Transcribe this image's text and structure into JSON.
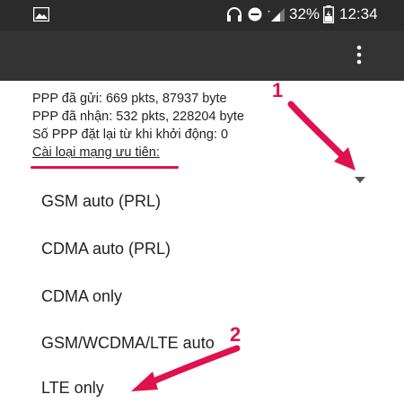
{
  "status_bar": {
    "battery_percent": "32%",
    "time": "12:34",
    "icons": [
      "image-icon",
      "headset-icon",
      "do-not-disturb-icon",
      "signal-icon",
      "battery-icon"
    ]
  },
  "app_bar": {
    "menu_icon": "more-vert-icon"
  },
  "info": {
    "ppp_sent": "PPP đã gửi: 669 pkts, 87937 byte",
    "ppp_received": "PPP đã nhận: 532 pkts, 228204 byte",
    "ppp_resets": "Số PPP đặt lại từ khi khởi động: 0",
    "preferred_network_label": "Cài loại mạng ưu tiên:"
  },
  "network_options": [
    "GSM auto (PRL)",
    "CDMA auto (PRL)",
    "CDMA only",
    "GSM/WCDMA/LTE auto",
    "LTE only"
  ],
  "annotations": {
    "step1": "1",
    "step2": "2",
    "accent_color": "#e0114d"
  }
}
